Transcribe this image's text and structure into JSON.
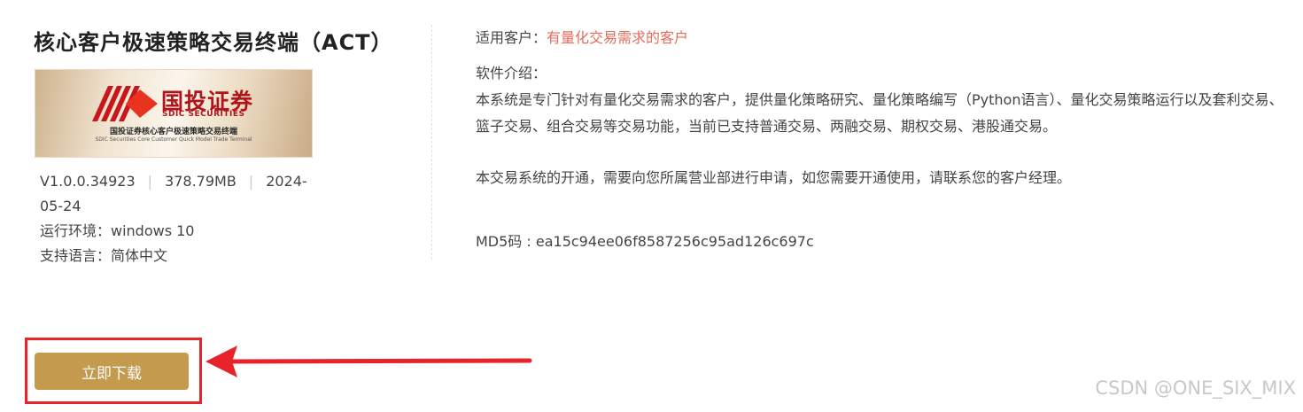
{
  "product": {
    "title": "核心客户极速策略交易终端（ACT）",
    "banner": {
      "brand_cn": "国投证券",
      "brand_en": "SDIC SECURITIES",
      "subtitle_cn": "国投证券核心客户极速策略交易终端",
      "subtitle_en": "SDIC Securities Core Customer Quick Model Trade Terminal"
    },
    "version": "V1.0.0.34923",
    "size": "378.79MB",
    "date_part1": "2024-",
    "date_part2": "05-24",
    "runtime": "运行环境：windows 10",
    "language": "支持语言：简体中文"
  },
  "details": {
    "suitable_label": "适用客户：",
    "suitable_value": "有量化交易需求的客户",
    "intro_label": "软件介绍：",
    "intro_text": "本系统是专门针对有量化交易需求的客户，提供量化策略研究、量化策略编写（Python语言）、量化交易策略运行以及套利交易、篮子交易、组合交易等交易功能，当前已支持普通交易、两融交易、期权交易、港股通交易。",
    "open_text": "本交易系统的开通，需要向您所属营业部进行申请，如您需要开通使用，请联系您的客户经理。",
    "md5": "MD5码 : ea15c94ee06f8587256c95ad126c697c"
  },
  "actions": {
    "download_label": "立即下载"
  },
  "colors": {
    "accent_gold": "#c49a4e",
    "highlight_red": "#e8232a",
    "brand_red": "#b0151b",
    "suitable_red": "#e56b5d"
  },
  "watermark": "CSDN @ONE_SIX_MIX"
}
